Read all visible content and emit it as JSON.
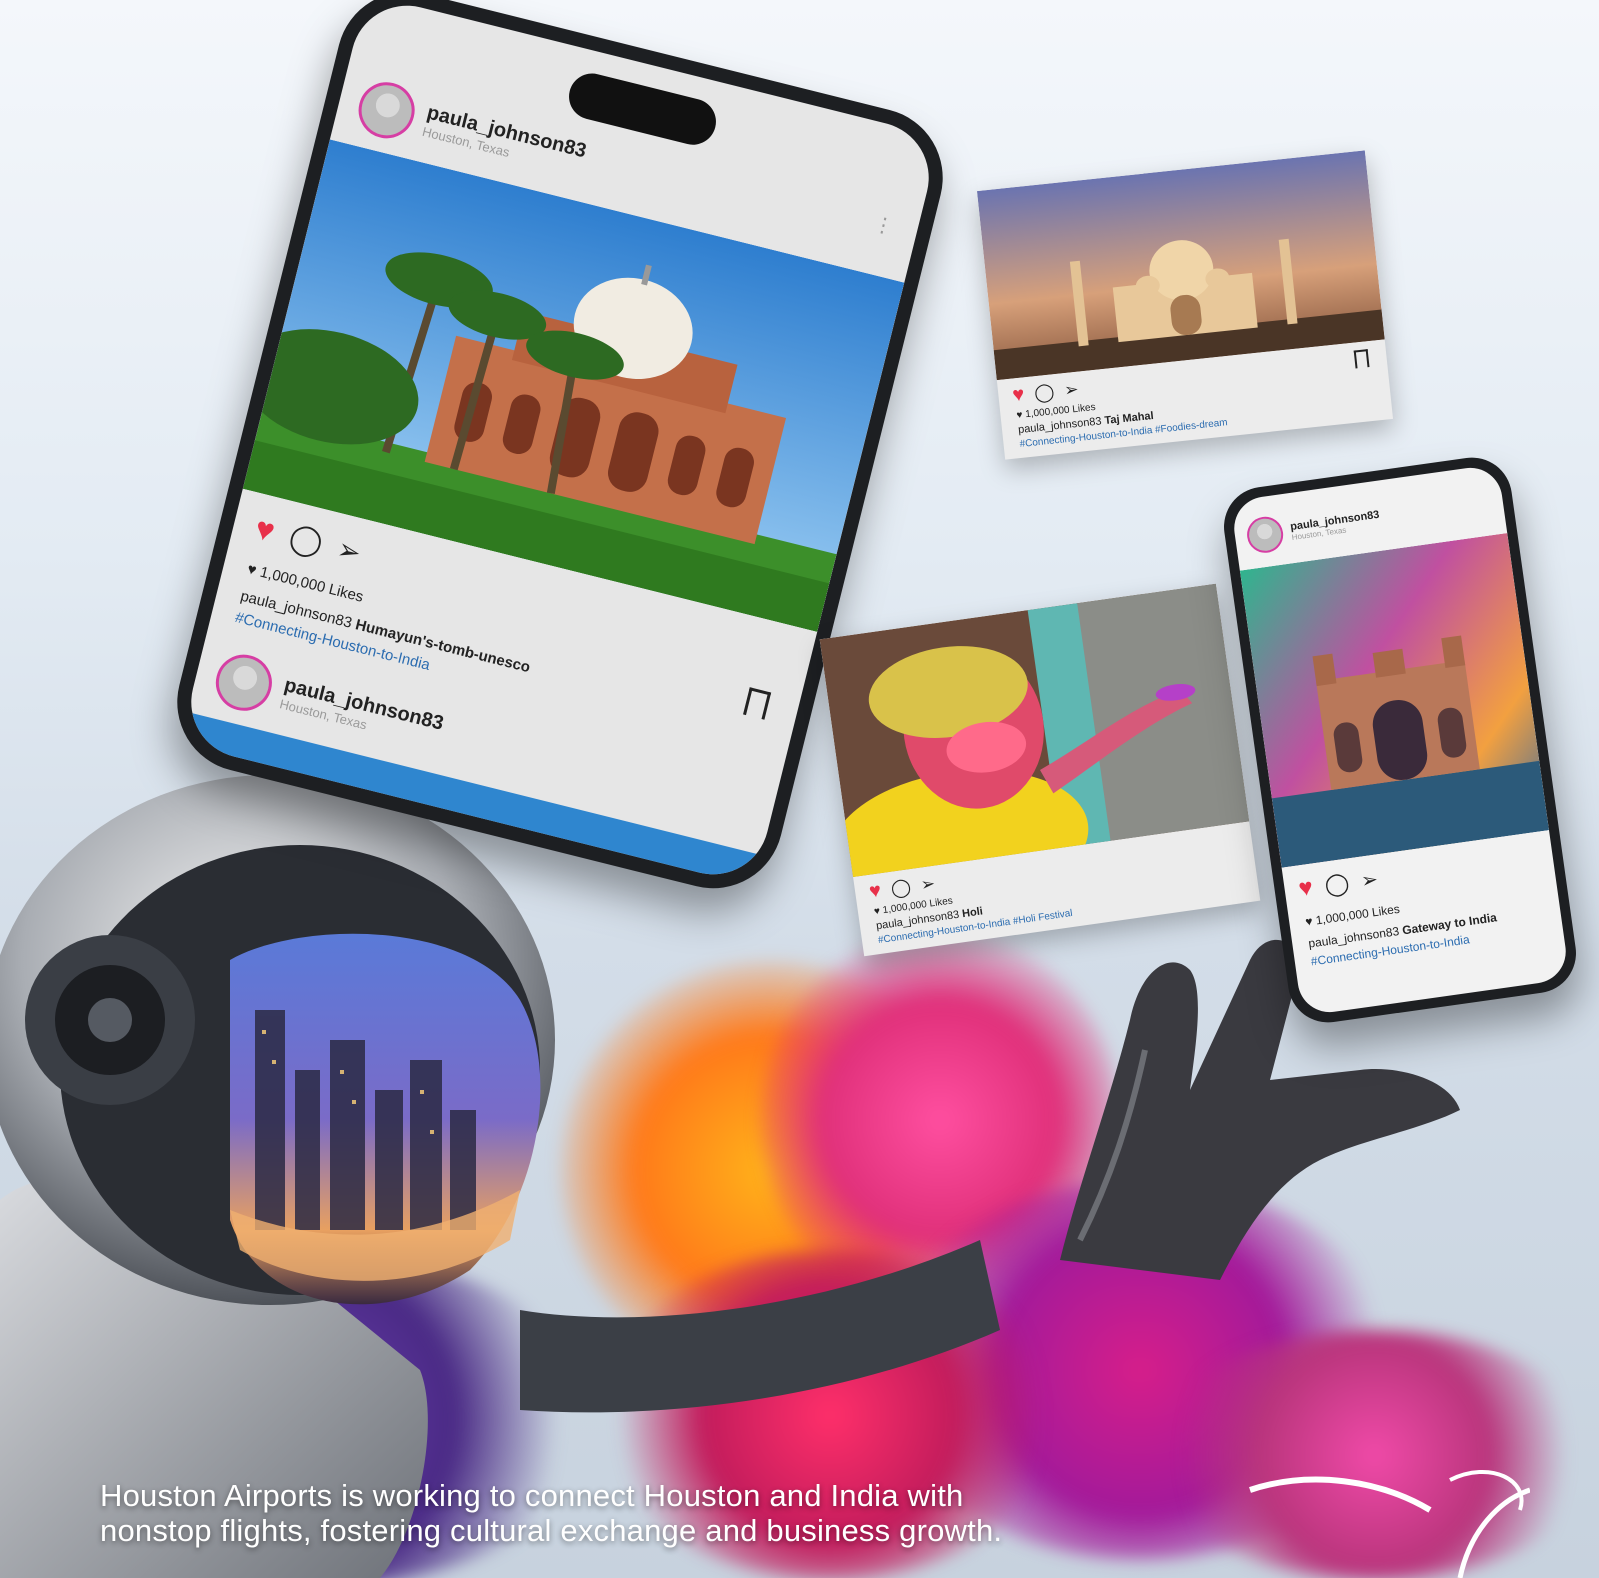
{
  "main_phone": {
    "post1": {
      "username": "paula_johnson83",
      "location": "Houston, Texas",
      "likes": "1,000,000 Likes",
      "caption_user": "paula_johnson83",
      "caption_text": "Humayun's-tomb-unesco",
      "hashtags": "#Connecting-Houston-to-India"
    },
    "post2": {
      "username": "paula_johnson83",
      "location": "Houston, Texas"
    }
  },
  "card_taj": {
    "likes": "1,000,000 Likes",
    "caption_user": "paula_johnson83",
    "caption_text": "Taj Mahal",
    "hashtags": "#Connecting-Houston-to-India #Foodies-dream"
  },
  "card_holi": {
    "likes": "1,000,000 Likes",
    "caption_user": "paula_johnson83",
    "caption_text": "Holi",
    "hashtags": "#Connecting-Houston-to-India #Holi Festival"
  },
  "small_phone": {
    "username": "paula_johnson83",
    "location": "Houston, Texas",
    "likes": "1,000,000 Likes",
    "caption_user": "paula_johnson83",
    "caption_text": "Gateway to India",
    "hashtags": "#Connecting-Houston-to-India"
  },
  "tagline": {
    "line1": "Houston Airports is working to connect Houston and India with",
    "line2": "nonstop flights, fostering cultural exchange and business growth."
  },
  "colors": {
    "heart": "#e8304a",
    "hashtag": "#2b6cb0",
    "avatar_ring": "#d63ea4"
  }
}
